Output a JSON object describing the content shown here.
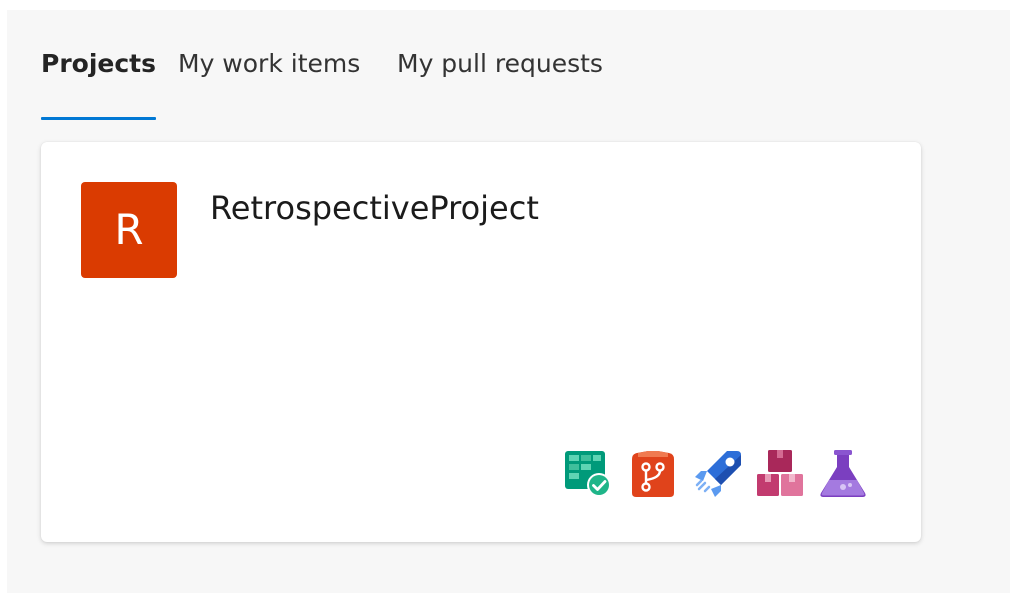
{
  "tabs": [
    {
      "label": "Projects",
      "active": true
    },
    {
      "label": "My work items",
      "active": false
    },
    {
      "label": "My pull requests",
      "active": false
    }
  ],
  "project": {
    "initial": "R",
    "name": "RetrospectiveProject",
    "avatar_color": "#da3b01"
  },
  "services": [
    {
      "icon": "boards-icon"
    },
    {
      "icon": "repos-icon"
    },
    {
      "icon": "pipelines-icon"
    },
    {
      "icon": "artifacts-icon"
    },
    {
      "icon": "test-plans-icon"
    }
  ],
  "colors": {
    "accent": "#0078d4",
    "boards": "#009a7a",
    "repos": "#e0431b",
    "pipelines": "#2d6ed8",
    "artifacts": "#c23b6f",
    "test_plans": "#7b3fc0"
  }
}
